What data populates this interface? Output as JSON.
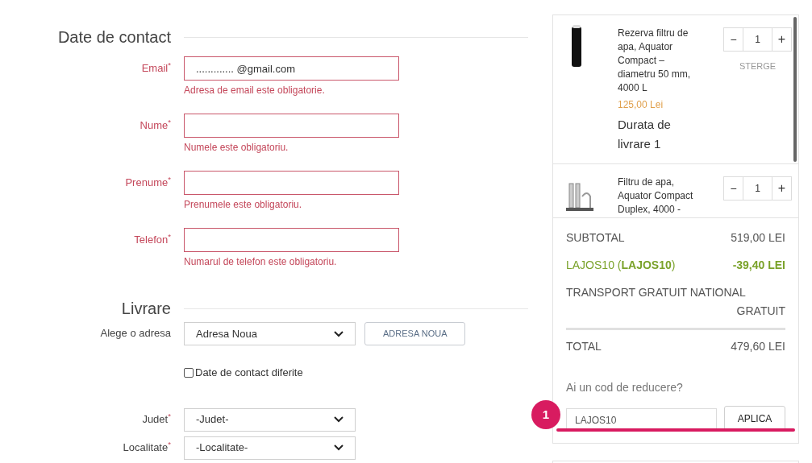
{
  "contact": {
    "title": "Date de contact",
    "fields": [
      {
        "label": "Email",
        "required_mark": "*",
        "value": "............. @gmail.com",
        "error": "Adresa de email este obligatorie.",
        "invalid": true
      },
      {
        "label": "Nume",
        "required_mark": "*",
        "error": "Numele este obligatoriu.",
        "invalid": true
      },
      {
        "label": "Prenume",
        "required_mark": "*",
        "error": "Prenumele este obligatoriu.",
        "invalid": true
      },
      {
        "label": "Telefon",
        "required_mark": "*",
        "error": "Numarul de telefon este obligatoriu.",
        "invalid": true
      }
    ]
  },
  "delivery": {
    "title": "Livrare",
    "address_label": "Alege o adresa",
    "address_select": "Adresa Noua",
    "new_address_button": "ADRESA NOUA",
    "different_contact": {
      "label": "Date de contact diferite",
      "checked": false
    },
    "fields": [
      {
        "label": "Judet",
        "required_mark": "*",
        "select": "-Judet-"
      },
      {
        "label": "Localitate",
        "required_mark": "*",
        "select": "-Localitate-"
      }
    ]
  },
  "cart": {
    "items": [
      {
        "name": "Rezerva filtru de apa, Aquator Compact – diametru 50 mm, 4000 L",
        "price": "125,00 Lei",
        "delivery": "Durata de livrare 1",
        "quantity": "1",
        "minus": "−",
        "plus": "+",
        "remove": "STERGE",
        "kind": "cartridge"
      },
      {
        "name": "Filtru de apa, Aquator Compact Duplex, 4000 -",
        "quantity": "1",
        "minus": "−",
        "plus": "+",
        "kind": "duplex"
      }
    ],
    "summary": {
      "subtotal_label": "SUBTOTAL",
      "subtotal": "519,00 LEI",
      "discount_label": "LAJOS10 (**LAJOS10**)",
      "discount": "-39,40 LEI",
      "shipping_label": "TRANSPORT GRATUIT NATIONAL",
      "shipping": "GRATUIT",
      "total_label": "TOTAL",
      "total": "479,60 LEI"
    },
    "coupon": {
      "prompt": "Ai un cod de reducere?",
      "value": "LAJOS10",
      "button": "APLICA"
    }
  },
  "annotation": {
    "number": "1"
  }
}
